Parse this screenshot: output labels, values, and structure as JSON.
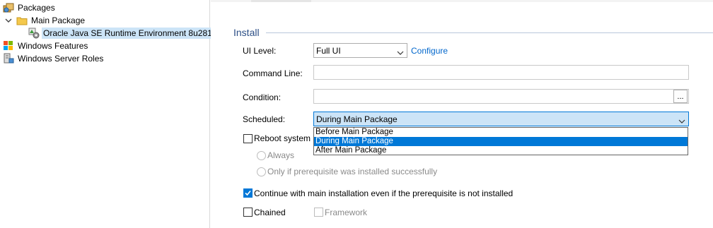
{
  "tree": {
    "items": [
      {
        "label": "Packages",
        "icon": "packages-icon"
      },
      {
        "label": "Main Package",
        "icon": "folder-icon"
      },
      {
        "label": "Oracle Java SE Runtime Environment 8u281",
        "icon": "package-icon"
      },
      {
        "label": "Windows Features",
        "icon": "windows-features-icon"
      },
      {
        "label": "Windows Server Roles",
        "icon": "server-roles-icon"
      }
    ]
  },
  "install": {
    "section_title": "Install",
    "ui_level_label": "UI Level:",
    "ui_level_value": "Full UI",
    "configure_link": "Configure",
    "command_line_label": "Command Line:",
    "condition_label": "Condition:",
    "condition_button": "...",
    "scheduled_label": "Scheduled:",
    "scheduled_value": "During Main Package",
    "scheduled_options": [
      "Before Main Package",
      "During Main Package",
      "After Main Package"
    ],
    "reboot_label": "Reboot system at",
    "always_label": "Always",
    "only_if_label": "Only if prerequisite was installed successfully",
    "continue_label": "Continue with main installation even if the prerequisite is not installed",
    "chained_label": "Chained",
    "framework_label": "Framework"
  },
  "colors": {
    "accent": "#0078d7",
    "section_title": "#2c4f86",
    "link": "#0066cc"
  }
}
